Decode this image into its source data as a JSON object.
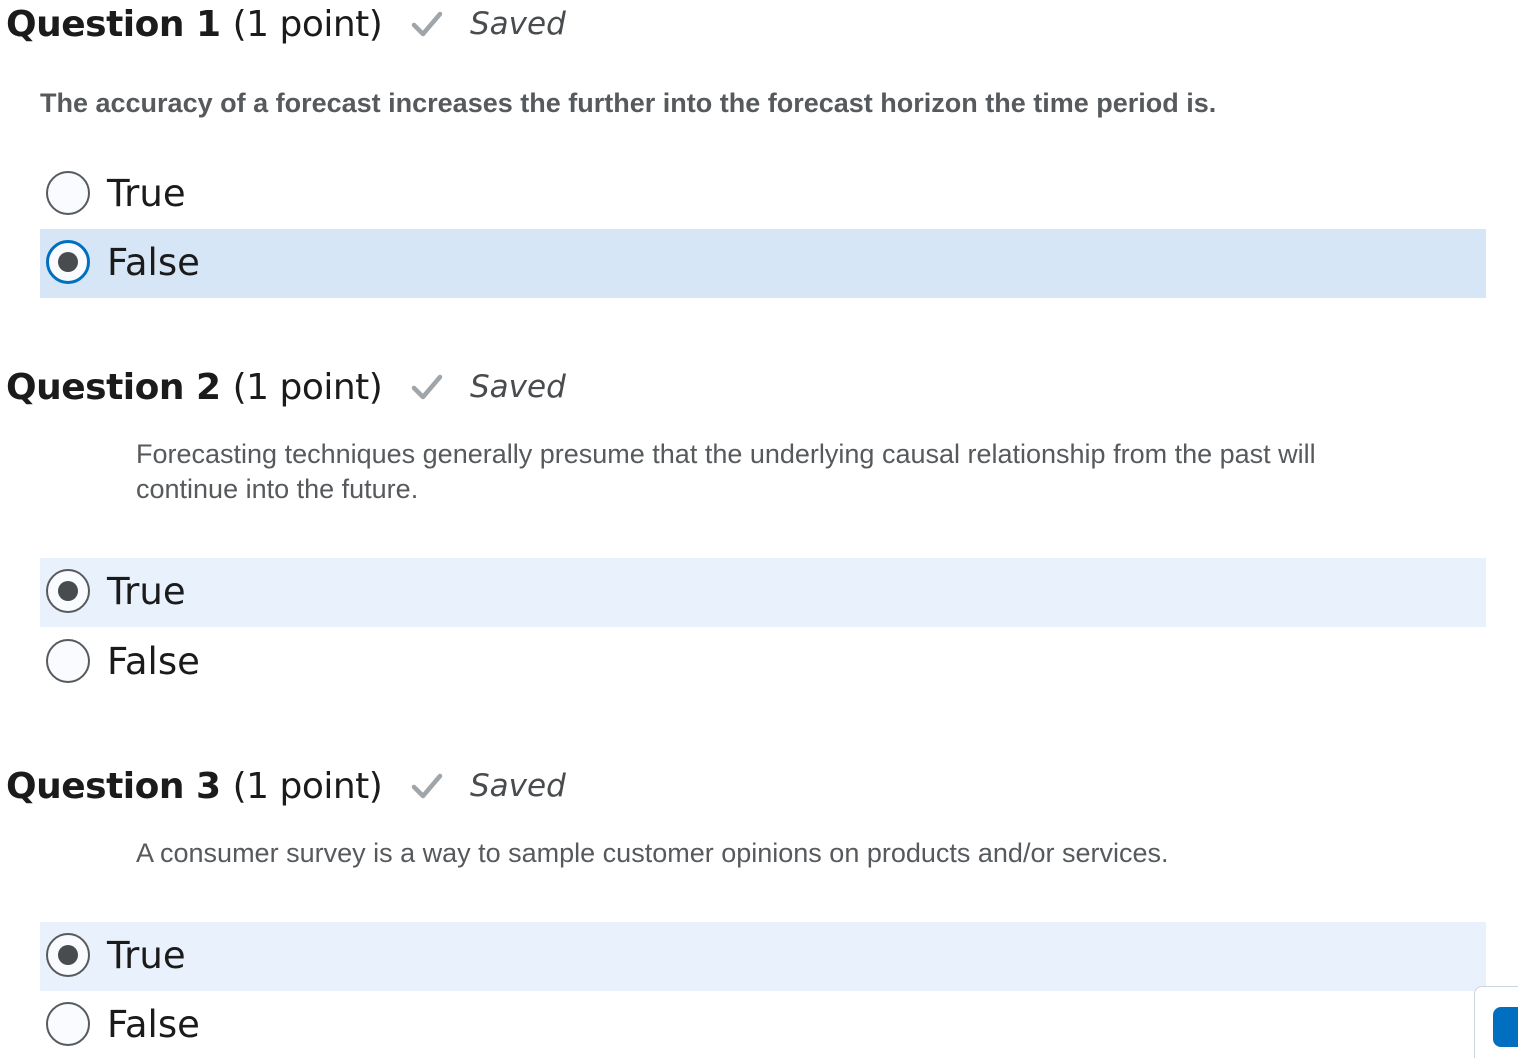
{
  "questions": [
    {
      "title": "Question 1",
      "points": "(1 point)",
      "status": "Saved",
      "status_icon": "checkmark-icon",
      "text": "The accuracy of a forecast increases the further into the forecast horizon the time period is.",
      "options": [
        {
          "label": "True",
          "checked": false
        },
        {
          "label": "False",
          "checked": true
        }
      ]
    },
    {
      "title": "Question 2",
      "points": "(1 point)",
      "status": "Saved",
      "status_icon": "checkmark-icon",
      "text_line1": "Forecasting techniques generally presume that the underlying causal relationship from the past will",
      "text_line2": "continue into the future.",
      "options": [
        {
          "label": "True",
          "checked": true
        },
        {
          "label": "False",
          "checked": false
        }
      ]
    },
    {
      "title": "Question 3",
      "points": "(1 point)",
      "status": "Saved",
      "status_icon": "checkmark-icon",
      "text": "A consumer survey is a way to sample customer opinions on products and/or services.",
      "options": [
        {
          "label": "True",
          "checked": true
        },
        {
          "label": "False",
          "checked": false
        }
      ]
    }
  ],
  "help_tab": {
    "icon": "chat-help-icon"
  },
  "colors": {
    "selected_bg": "#e8f1fc",
    "focused_selected_bg": "#d6e6f7",
    "focus_ring": "#006fbf",
    "check_gray": "#a0a5a9",
    "question_text": "#565a5c"
  }
}
